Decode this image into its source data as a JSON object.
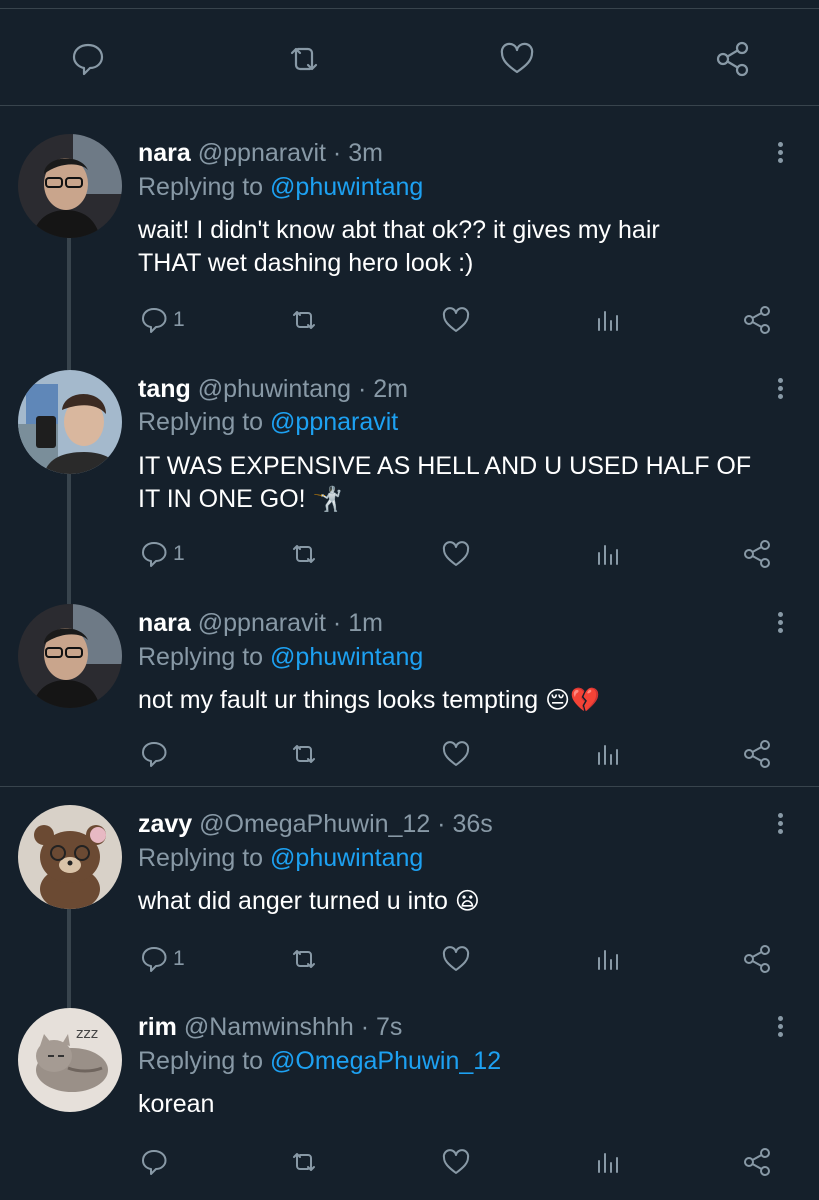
{
  "top_actions": {
    "icons": [
      "reply-icon",
      "retweet-icon",
      "like-icon",
      "share-icon"
    ]
  },
  "tweets": [
    {
      "name": "nara",
      "meta": "@ppnaravit · 3m",
      "replying_prefix": "Replying to ",
      "replying_to": "@phuwintang",
      "text_lines": [
        "wait! I didn't know abt that ok?? it gives my hair",
        "THAT wet dashing hero look :)"
      ],
      "reply_count": "1"
    },
    {
      "name": "tang",
      "meta": "@phuwintang · 2m",
      "replying_prefix": "Replying to ",
      "replying_to": "@ppnaravit",
      "text_lines": [
        "IT WAS EXPENSIVE AS HELL AND U USED HALF OF",
        "IT IN ONE GO!"
      ],
      "emoji": "🤺",
      "reply_count": "1"
    },
    {
      "name": "nara",
      "meta": "@ppnaravit · 1m",
      "replying_prefix": "Replying to ",
      "replying_to": "@phuwintang",
      "text": "not my fault ur things looks tempting",
      "emoji": "😔💔",
      "reply_count": ""
    },
    {
      "name": "zavy",
      "meta": "@OmegaPhuwin_12 · 36s",
      "replying_prefix": "Replying to ",
      "replying_to": "@phuwintang",
      "text": "what did anger turned u into",
      "emoji": "😦",
      "reply_count": "1"
    },
    {
      "name": "rim",
      "meta": "@Namwinshhh · 7s",
      "replying_prefix": "Replying to ",
      "replying_to": "@OmegaPhuwin_12",
      "text": "korean",
      "reply_count": ""
    }
  ],
  "colors": {
    "background": "#15202b",
    "divider": "#38444d",
    "muted": "#8899a6",
    "mention": "#1da1f2",
    "text": "#ffffff"
  }
}
